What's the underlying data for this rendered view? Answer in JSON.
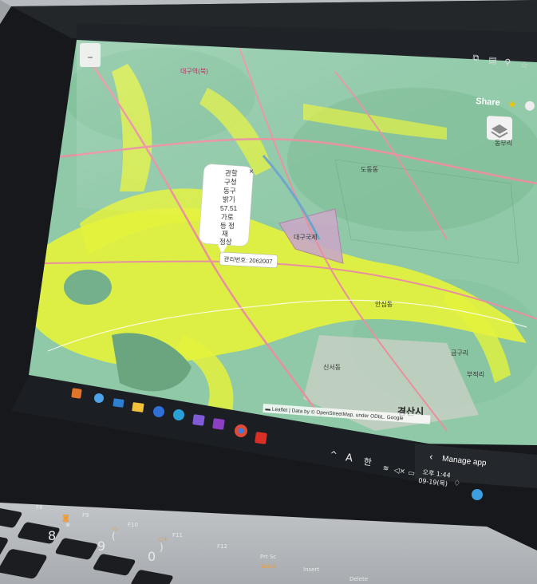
{
  "browser": {
    "share_label": "Share",
    "icons": [
      "open-in-app-icon",
      "reader-icon",
      "zoom-icon",
      "bookmark-star-icon",
      "github-icon"
    ]
  },
  "map": {
    "popup": {
      "lines": [
        "관할",
        "구청",
        "동구",
        "밝기",
        "57.51",
        "가로",
        "등 정",
        "재",
        "정상"
      ],
      "close": "×",
      "id_label": "관리번호: 2062007"
    },
    "attribution": "▬ Leaflet | Data by © OpenStreetMap, under ODbL. Google",
    "place_labels": {
      "city": "경산시",
      "top_left": "대구역(북)",
      "right_1": "동부리",
      "right_2": "도동동",
      "center": "대구국제",
      "lower_1": "안심동",
      "lower_2": "금구리",
      "lower_3": "부적리",
      "lower_4": "신서동"
    }
  },
  "taskbar": {
    "tray": {
      "chevron": "^",
      "font_a": "A",
      "ime": "한",
      "time": "오후 1:44",
      "date": "09-19(목)"
    },
    "manage_app": "Manage app",
    "icons": [
      "copilot-icon",
      "settings-icon",
      "mail-icon",
      "folder-icon",
      "media-icon",
      "edge-icon",
      "store-icon",
      "onenote-icon",
      "chrome-icon",
      "pdf-icon"
    ]
  },
  "keyboard": {
    "keys": [
      "F8",
      "F9",
      "F10",
      "F11",
      "F12",
      "Prt Sc",
      "ScrLk",
      "Insert",
      "Delete",
      "8",
      "9",
      "0",
      "*",
      "(",
      ")"
    ],
    "fn_glyphs": [
      "🔇",
      "◁-",
      "◁+"
    ]
  },
  "colors": {
    "map_green": "#8fc9a8",
    "map_yellow": "#e4f23c",
    "bezel": "#16181b",
    "keyboard_body": "#c0c3c7",
    "key": "#1b1d20"
  }
}
